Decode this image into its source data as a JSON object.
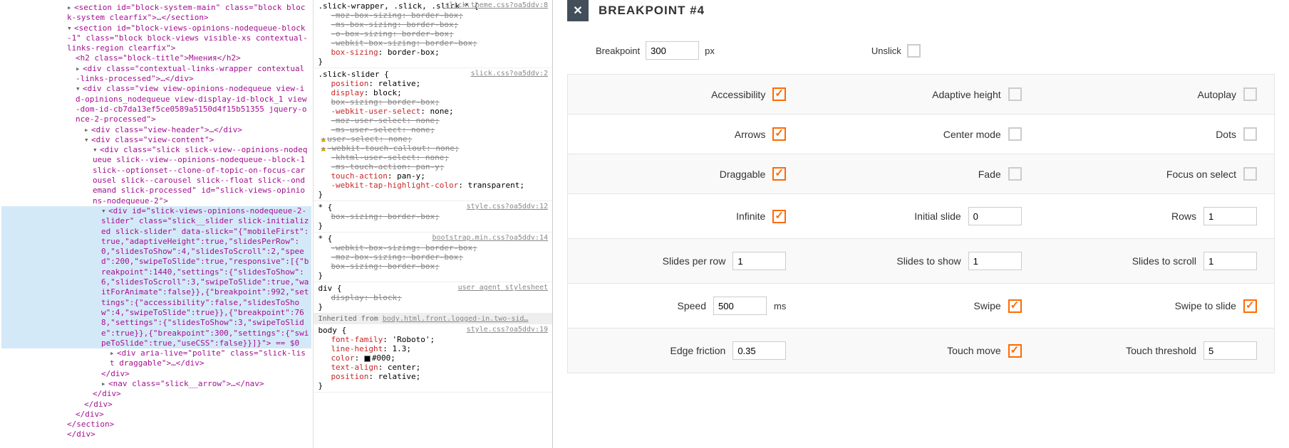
{
  "dom": {
    "l1": "<section id=\"block-system-main\" class=\"block block-system clearfix\">…</section>",
    "l2": "<section id=\"block-views-opinions-nodequeue-block-1\" class=\"block block-views visible-xs contextual-links-region clearfix\">",
    "l3": "<h2 class=\"block-title\">Мнения</h2>",
    "l4": "<div class=\"contextual-links-wrapper contextual-links-processed\">…</div>",
    "l5": "<div class=\"view view-opinions-nodequeue view-id-opinions_nodequeue view-display-id-block_1 view-dom-id-cb7da13ef5ce0589a5150d4f15b51355 jquery-once-2-processed\">",
    "l6": "<div class=\"view-header\">…</div>",
    "l7": "<div class=\"view-content\">",
    "l8": "<div class=\"slick slick-view--opinions-nodequeue slick--view--opinions-nodequeue--block-1 slick--optionset--clone-of-topic-on-focus-carousel slick--carousel slick--float slick--ondemand slick-processed\" id=\"slick-views-opinions-nodequeue-2\">",
    "sel": "<div id=\"slick-views-opinions-nodequeue-2-slider\" class=\"slick__slider slick-initialized slick-slider\" data-slick=\"{\"mobileFirst\":true,\"adaptiveHeight\":true,\"slidesPerRow\":0,\"slidesToShow\":4,\"slidesToScroll\":2,\"speed\":200,\"swipeToSlide\":true,\"responsive\":[{\"breakpoint\":1440,\"settings\":{\"slidesToShow\":6,\"slidesToScroll\":3,\"swipeToSlide\":true,\"waitForAnimate\":false}},{\"breakpoint\":992,\"settings\":{\"accessibility\":false,\"slidesToShow\":4,\"swipeToSlide\":true}},{\"breakpoint\":768,\"settings\":{\"slidesToShow\":3,\"swipeToSlide\":true}},{\"breakpoint\":300,\"settings\":{\"swipeToSlide\":true,\"useCSS\":false}}]}\"> == $0",
    "l9": "<div aria-live=\"polite\" class=\"slick-list draggable\">…</div>",
    "l10": "</div>",
    "l11": "<nav class=\"slick__arrow\">…</nav>",
    "l12": "</div>",
    "l13": "</div>",
    "l14": "</div>",
    "l15": "</section>",
    "l16": "</div>"
  },
  "css": {
    "r1": {
      "sel": ".slick-wrapper, .slick, .slick * {",
      "src": "slick.theme.css?oa5ddv:8",
      "props": [
        {
          "n": "-moz-box-sizing",
          "v": "border-box;",
          "s": 1
        },
        {
          "n": "-ms-box-sizing",
          "v": "border-box;",
          "s": 1
        },
        {
          "n": "-o-box-sizing",
          "v": "border-box;",
          "s": 1
        },
        {
          "n": "-webkit-box-sizing",
          "v": "border-box;",
          "s": 1
        },
        {
          "n": "box-sizing",
          "v": "border-box;"
        }
      ]
    },
    "r2": {
      "sel": ".slick-slider {",
      "src": "slick.css?oa5ddv:2",
      "props": [
        {
          "n": "position",
          "v": "relative;"
        },
        {
          "n": "display",
          "v": "block;"
        },
        {
          "n": "box-sizing",
          "v": "border-box;",
          "s": 1
        },
        {
          "n": "-webkit-user-select",
          "v": "none;"
        },
        {
          "n": "-moz-user-select",
          "v": "none;",
          "s": 1
        },
        {
          "n": "-ms-user-select",
          "v": "none;",
          "s": 1
        },
        {
          "n": "user-select",
          "v": "none;",
          "s": 1,
          "w": 1
        },
        {
          "n": "-webkit-touch-callout",
          "v": "none;",
          "s": 1,
          "w": 1
        },
        {
          "n": "-khtml-user-select",
          "v": "none;",
          "s": 1
        },
        {
          "n": "-ms-touch-action",
          "v": "pan-y;",
          "s": 1
        },
        {
          "n": "touch-action",
          "v": "pan-y;"
        },
        {
          "n": "-webkit-tap-highlight-color",
          "v": "transparent;"
        }
      ]
    },
    "r3": {
      "sel": "* {",
      "src": "style.css?oa5ddv:12",
      "props": [
        {
          "n": "box-sizing",
          "v": "border-box;",
          "s": 1
        }
      ]
    },
    "r4": {
      "sel": "* {",
      "src": "bootstrap.min.css?oa5ddv:14",
      "props": [
        {
          "n": "-webkit-box-sizing",
          "v": "border-box;",
          "s": 1
        },
        {
          "n": "-moz-box-sizing",
          "v": "border-box;",
          "s": 1
        },
        {
          "n": "box-sizing",
          "v": "border-box;",
          "s": 1
        }
      ]
    },
    "r5": {
      "sel": "div {",
      "src": "user agent stylesheet",
      "props": [
        {
          "n": "display",
          "v": "block;",
          "s": 1
        }
      ]
    },
    "inh": "Inherited from ",
    "inhLink": "body.html.front.logged-in.two-sid…",
    "r6": {
      "sel": "body {",
      "src": "style.css?oa5ddv:19",
      "props": [
        {
          "n": "font-family",
          "v": "'Roboto';"
        },
        {
          "n": "line-height",
          "v": "1.3;"
        },
        {
          "n": "color",
          "v": "#000;",
          "c": "#000"
        },
        {
          "n": "text-align",
          "v": "center;"
        },
        {
          "n": "position",
          "v": "relative;"
        }
      ]
    }
  },
  "admin": {
    "title": "BREAKPOINT #4",
    "breakpoint_label": "Breakpoint",
    "breakpoint_val": "300",
    "px": "px",
    "unslick": "Unslick",
    "rows": [
      [
        {
          "l": "Accessibility",
          "t": "c",
          "on": 1
        },
        {
          "l": "Adaptive height",
          "t": "c",
          "on": 0
        },
        {
          "l": "Autoplay",
          "t": "c",
          "on": 0
        }
      ],
      [
        {
          "l": "Arrows",
          "t": "c",
          "on": 1
        },
        {
          "l": "Center mode",
          "t": "c",
          "on": 0
        },
        {
          "l": "Dots",
          "t": "c",
          "on": 0
        }
      ],
      [
        {
          "l": "Draggable",
          "t": "c",
          "on": 1
        },
        {
          "l": "Fade",
          "t": "c",
          "on": 0
        },
        {
          "l": "Focus on select",
          "t": "c",
          "on": 0
        }
      ],
      [
        {
          "l": "Infinite",
          "t": "c",
          "on": 1
        },
        {
          "l": "Initial slide",
          "t": "i",
          "v": "0"
        },
        {
          "l": "Rows",
          "t": "i",
          "v": "1"
        }
      ],
      [
        {
          "l": "Slides per row",
          "t": "i",
          "v": "1"
        },
        {
          "l": "Slides to show",
          "t": "i",
          "v": "1"
        },
        {
          "l": "Slides to scroll",
          "t": "i",
          "v": "1"
        }
      ],
      [
        {
          "l": "Speed",
          "t": "i",
          "v": "500",
          "u": "ms"
        },
        {
          "l": "Swipe",
          "t": "c",
          "on": 1
        },
        {
          "l": "Swipe to slide",
          "t": "c",
          "on": 1
        }
      ],
      [
        {
          "l": "Edge friction",
          "t": "i",
          "v": "0.35"
        },
        {
          "l": "Touch move",
          "t": "c",
          "on": 1
        },
        {
          "l": "Touch threshold",
          "t": "i",
          "v": "5"
        }
      ]
    ]
  }
}
